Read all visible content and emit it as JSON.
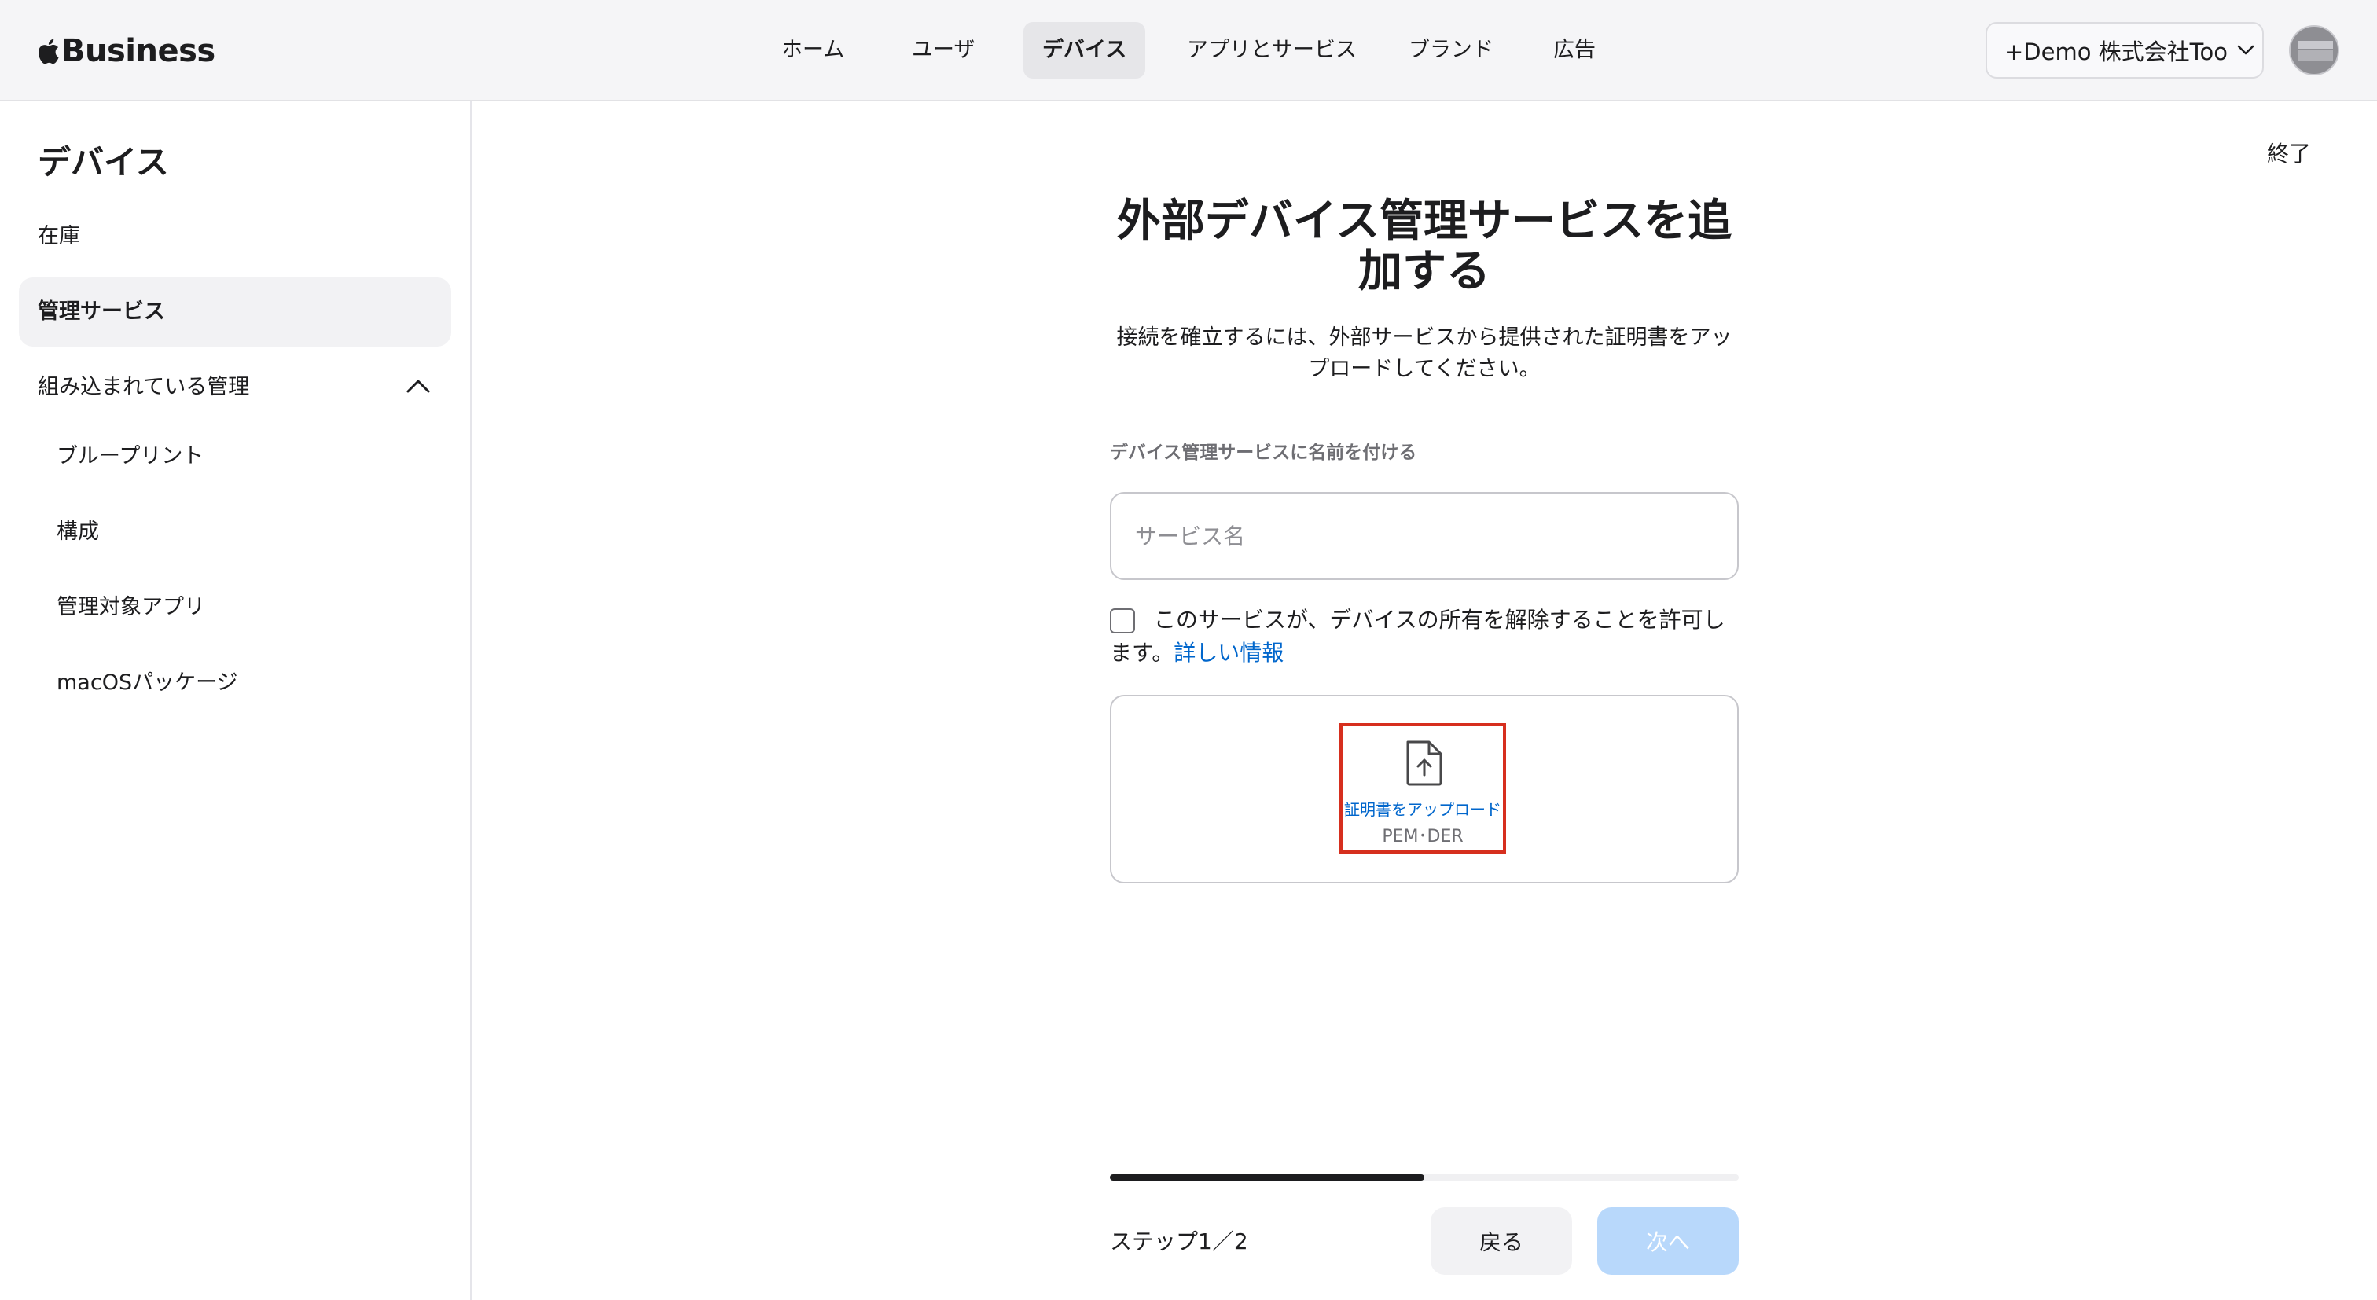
{
  "header": {
    "brand": "Business",
    "nav": [
      {
        "label": "ホーム",
        "active": false
      },
      {
        "label": "ユーザ",
        "active": false
      },
      {
        "label": "デバイス",
        "active": true
      },
      {
        "label": "アプリとサービス",
        "active": false
      },
      {
        "label": "ブランド",
        "active": false
      },
      {
        "label": "広告",
        "active": false
      }
    ],
    "org_label": "+Demo 株式会社Too"
  },
  "sidebar": {
    "title": "デバイス",
    "items": [
      {
        "label": "在庫"
      },
      {
        "label": "管理サービス",
        "active": true
      },
      {
        "label": "組み込まれている管理",
        "expanded": true
      },
      {
        "label": "ブループリント"
      },
      {
        "label": "構成"
      },
      {
        "label": "管理対象アプリ"
      },
      {
        "label": "macOSパッケージ"
      }
    ]
  },
  "main": {
    "finish_label": "終了",
    "title": "外部デバイス管理サービスを追加する",
    "subtitle": "接続を確立するには、外部サービスから提供された証明書をアップロードしてください。",
    "field_label": "デバイス管理サービスに名前を付ける",
    "input_placeholder": "サービス名",
    "input_value": "",
    "checkbox_text": "このサービスが、デバイスの所有を解除することを許可します。",
    "checkbox_checked": false,
    "learn_more": "詳しい情報",
    "upload_label": "証明書をアップロード",
    "upload_formats": "PEM･DER",
    "progress": 0.5,
    "step_text": "ステップ1／2",
    "back_label": "戻る",
    "next_label": "次へ"
  },
  "colors": {
    "accent": "#0066cc",
    "highlight_border": "#d62f1e",
    "next_disabled": "#b8d8fb"
  }
}
